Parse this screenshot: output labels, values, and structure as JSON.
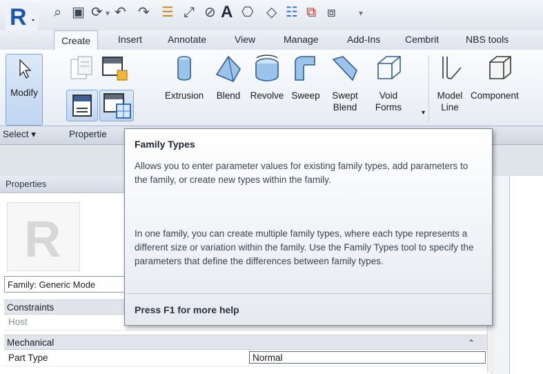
{
  "quick_access": {
    "icons": [
      "open-folder-icon",
      "save-icon",
      "sync-icon",
      "undo-icon",
      "redo-icon",
      "thin-lines-icon",
      "measure-icon",
      "dimension-icon",
      "text-icon",
      "3d-view-icon",
      "section-icon",
      "tag-icon",
      "close-windows-icon",
      "switch-windows-icon"
    ],
    "text_tool_glyph": "A",
    "dropdown_glyph": "▾"
  },
  "tabs": [
    "Create",
    "Insert",
    "Annotate",
    "View",
    "Manage",
    "Add-Ins",
    "Cembrit",
    "NBS tools"
  ],
  "active_tab": "Create",
  "ribbon": {
    "modify_label": "Modify",
    "tools": [
      {
        "name": "extrusion",
        "lines": [
          "Extrusion"
        ]
      },
      {
        "name": "blend",
        "lines": [
          "Blend"
        ]
      },
      {
        "name": "revolve",
        "lines": [
          "Revolve"
        ]
      },
      {
        "name": "sweep",
        "lines": [
          "Sweep"
        ]
      },
      {
        "name": "swept-blend",
        "lines": [
          "Swept",
          "Blend"
        ]
      },
      {
        "name": "void-forms",
        "lines": [
          "Void",
          "Forms"
        ]
      },
      {
        "name": "model-line",
        "lines": [
          "Model",
          "Line"
        ]
      },
      {
        "name": "component",
        "lines": [
          "Component"
        ]
      }
    ],
    "panels": {
      "select": "Select ▾",
      "properties": "Propertie"
    }
  },
  "properties_palette": {
    "title": "Properties",
    "close_glyph": "×",
    "type_selector": "Family: Generic Mode",
    "categories": [
      {
        "label": "Constraints",
        "rows": [
          {
            "name": "Host",
            "value": ""
          }
        ]
      },
      {
        "label": "Mechanical",
        "rows": [
          {
            "name": "Part Type",
            "value": "Normal"
          }
        ]
      }
    ]
  },
  "tooltip": {
    "title": "Family Types",
    "description": "Allows you to enter parameter values for existing family types, add parameters to the family, or create new types within the family.",
    "detail": "In one family, you can create multiple family types, where each type represents a different size or variation within the family. Use the Family Types tool to specify the parameters that define the differences between family types.",
    "help": "Press F1 for more help"
  },
  "colors": {
    "accent": "#2b6fc6",
    "app_logo": "#1a55b5",
    "tooltip_border": "#7c8594"
  }
}
